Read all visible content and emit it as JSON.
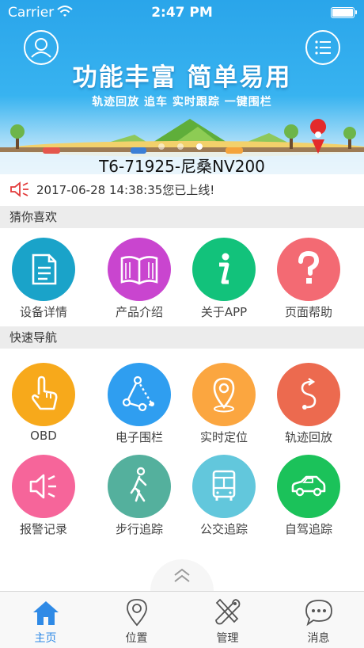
{
  "status_bar": {
    "carrier": "Carrier",
    "time": "2:47 PM"
  },
  "banner": {
    "slogan": "功能丰富 简单易用",
    "subtitle": "轨迹回放 追车 实时跟踪 一键围栏",
    "vehicle_plate": "T6-71925-尼桑NV200",
    "carousel": {
      "page_count": 3,
      "active_index": 2
    },
    "left_button_icon": "user-icon",
    "right_button_icon": "menu-list-icon"
  },
  "notice": {
    "icon": "speaker-icon",
    "text": "2017-06-28 14:38:35您已上线!"
  },
  "favorites": {
    "title": "猜你喜欢",
    "items": [
      {
        "label": "设备详情",
        "icon": "document-icon",
        "color": "#1aa3c9"
      },
      {
        "label": "产品介绍",
        "icon": "open-book-icon",
        "color": "#c945cf"
      },
      {
        "label": "关于APP",
        "icon": "info-icon",
        "color": "#12c27b"
      },
      {
        "label": "页面帮助",
        "icon": "question-icon",
        "color": "#f36a73"
      }
    ]
  },
  "quick_nav": {
    "title": "快速导航",
    "items": [
      {
        "label": "OBD",
        "icon": "hand-pointer-icon",
        "color": "#f7a91b"
      },
      {
        "label": "电子围栏",
        "icon": "geofence-icon",
        "color": "#2f9ef0"
      },
      {
        "label": "实时定位",
        "icon": "location-pin-icon",
        "color": "#fba640"
      },
      {
        "label": "轨迹回放",
        "icon": "track-replay-icon",
        "color": "#ec6a4f"
      },
      {
        "label": "报警记录",
        "icon": "alarm-speaker-icon",
        "color": "#f6659a"
      },
      {
        "label": "步行追踪",
        "icon": "walking-icon",
        "color": "#54b09d"
      },
      {
        "label": "公交追踪",
        "icon": "bus-icon",
        "color": "#62c7dc"
      },
      {
        "label": "自驾追踪",
        "icon": "car-icon",
        "color": "#1bc25a"
      }
    ]
  },
  "tabbar": {
    "active_color": "#2f8ae6",
    "tabs": [
      {
        "label": "主页",
        "icon": "home-icon",
        "active": true
      },
      {
        "label": "位置",
        "icon": "location-icon",
        "active": false
      },
      {
        "label": "管理",
        "icon": "tools-icon",
        "active": false
      },
      {
        "label": "消息",
        "icon": "chat-bubble-icon",
        "active": false
      }
    ]
  }
}
